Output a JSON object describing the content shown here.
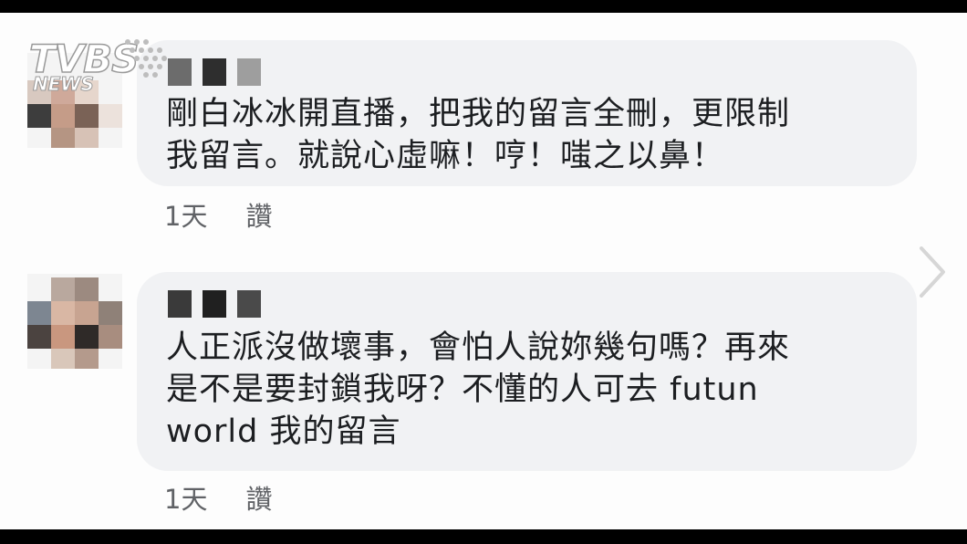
{
  "watermark": {
    "brand": "TVBS",
    "sub": "NEWS"
  },
  "comments": [
    {
      "text_lines": [
        "剛白冰冰開直播，把我的留言全刪，更限制",
        "我留言。就說心虛嘛！哼！嗤之以鼻！"
      ],
      "time": "1天",
      "like_label": "讚"
    },
    {
      "text_lines": [
        "人正派沒做壞事，會怕人說妳幾句嗎？再來",
        "是不是要封鎖我呀？不懂的人可去 futun",
        "world 我的留言"
      ],
      "time": "1天",
      "like_label": "讚"
    }
  ],
  "icons": {
    "next": "chevron-right-icon"
  }
}
